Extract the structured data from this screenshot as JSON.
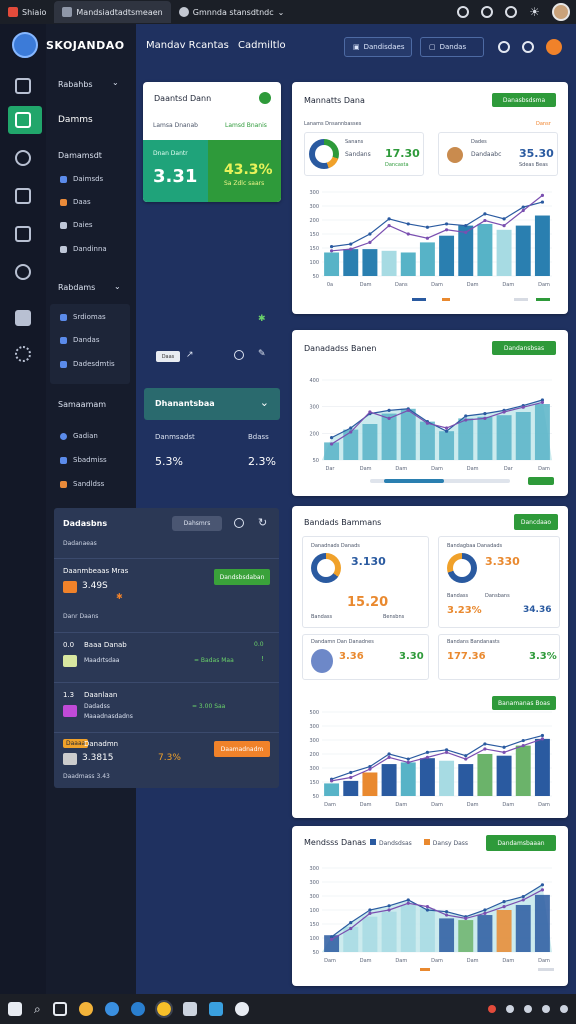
{
  "browser": {
    "tabs": [
      {
        "label": "Shiaio"
      },
      {
        "label": "Mandsiadtadtsmeaen"
      },
      {
        "label": "Gmnnda stansdtndc"
      }
    ]
  },
  "sidebar": {
    "brand": "SKOJANDAO",
    "section1": "Rabahbs",
    "active_item": "Damms",
    "group1_title": "Damamsdt",
    "group1_items": [
      "Daimsds",
      "Daas",
      "Daies",
      "Dandinna"
    ],
    "section2": "Rabdams",
    "group2_items": [
      "Srdiomas",
      "Dandas",
      "Dadesdmtis"
    ],
    "section3": "Samaamam",
    "group3_items": [
      "Gadian",
      "Sbadmiss",
      "Sandldss"
    ]
  },
  "header": {
    "title": "Mandav Rcantas",
    "subtitle": "Cadmiltlo",
    "btn1": "Dandisdaes",
    "btn2": "Dandas"
  },
  "kpi_card": {
    "title": "Daantsd Dann",
    "left_label": "Lamsa Dnanab",
    "right_label": "Lamsd Bnanis",
    "tile_caption": "Dnan Dantr",
    "tile_value": "3.31",
    "tile2_value": "43.3%",
    "tile2_caption": "Sa Zdlc saars"
  },
  "toolbar_mid": {
    "btn": "Daas"
  },
  "accordion": {
    "title": "Dhanantsbaa",
    "label": "Danmsadst",
    "right_label": "Bdass",
    "value_left": "5.3%",
    "value_right": "2.3%"
  },
  "left_panel": {
    "title": "Dadasbns",
    "btn": "Dahsmrs",
    "subtitle": "Dadanaeas",
    "row1": {
      "title": "Daanmbeaas Mras",
      "value": "3.49S",
      "btn": "Dandsbsdaban",
      "caption": "Danr Daans"
    },
    "row2": {
      "code": "0.0",
      "title": "Baaa Danab",
      "sub": "Maadrtsdaa",
      "mid": "= Badas Maa",
      "right_badge": "0.0"
    },
    "row3": {
      "code": "1.3",
      "title": "Daanlaan",
      "sub": "Dadadss",
      "sub2": "Maaadnasdadns",
      "mid": "= 3.00 Saa"
    },
    "row4": {
      "badge": "Daaaa",
      "title": "Danadmn",
      "value": "3.3815",
      "pct": "7.3%",
      "btn": "Daamadnadm",
      "caption": "Daadmass 3.43"
    }
  },
  "chart1": {
    "title": "Mannatts Dana",
    "btn": "Danasbsdsma",
    "mini_left": {
      "label": "Sanans",
      "title": "Sandans",
      "value": "17.30",
      "caption": "Dancasta"
    },
    "mini_right": {
      "label": "Dades",
      "title": "Dandaabc",
      "value": "35.30",
      "caption": "Sdeas Beas"
    },
    "header_left": "Lanams Dnsannbasses",
    "header_right": "Dansr"
  },
  "chart2": {
    "title": "Danadadss Banen",
    "btn": "Dandansbsas"
  },
  "chart3": {
    "title": "Bandads Bammans",
    "btn": "Dancdaao",
    "stat1": {
      "title": "Danadnads Danads",
      "value": "3.130",
      "value2": "15.20",
      "label_a": "Bandass",
      "label_b": "Bensbns"
    },
    "stat2": {
      "title": "Bandagbaa Danadads",
      "value": "3.330",
      "value2": "3.23%",
      "label_a": "Bandass",
      "label_b": "Dansbans",
      "value3": "34.36"
    },
    "stat3": {
      "title": "Dandamn Dan Danadnes",
      "value": "3.36",
      "value2": "3.30"
    },
    "stat4": {
      "title": "Bandans Bandanasts",
      "value": "177.36",
      "value2": "3.3%"
    },
    "inner_btn": "Banamanas Boas"
  },
  "chart4": {
    "title": "Mendsss Danas",
    "legend": [
      {
        "label": "Dandsdsas",
        "color": "#2a5aa0"
      },
      {
        "label": "Dansy Dass",
        "color": "#e9892f"
      }
    ],
    "btn": "Dandamsbaaan"
  },
  "colors": {
    "green": "#2e9a3a",
    "teal": "#57b3c7",
    "blue": "#2a5aa0",
    "orange": "#f0822a"
  },
  "chart_data": [
    {
      "type": "bar",
      "id": "chart1",
      "y_ticks": [
        "300",
        "300",
        "200",
        "150",
        "150",
        "100",
        "50"
      ],
      "x_ticks": [
        "0a",
        "Dam",
        "Dans",
        "Dam",
        "Dam",
        "Dam",
        "Dam"
      ],
      "bars": [
        28,
        32,
        32,
        30,
        28,
        40,
        48,
        60,
        62,
        55,
        60,
        72
      ],
      "bar_colors": [
        "#57b3c7",
        "#2a7fb0",
        "#2a7fb0",
        "#a7dbe3",
        "#57b3c7",
        "#57b3c7",
        "#2a7fb0",
        "#2a7fb0",
        "#57b3c7",
        "#a7dbe3",
        "#2a7fb0",
        "#2a7fb0"
      ],
      "line1": [
        35,
        38,
        50,
        68,
        62,
        58,
        62,
        60,
        74,
        68,
        82,
        88
      ],
      "line2": [
        30,
        32,
        40,
        60,
        50,
        45,
        55,
        52,
        66,
        60,
        78,
        96
      ]
    },
    {
      "type": "area",
      "id": "chart2",
      "y_ticks": [
        "400",
        "300",
        "200",
        "50"
      ],
      "x_ticks": [
        "Dar",
        "Dam",
        "Dam",
        "Dam",
        "Dam",
        "Dar",
        "Dam"
      ],
      "bars": [
        22,
        38,
        45,
        58,
        64,
        48,
        36,
        52,
        54,
        56,
        60,
        70
      ],
      "line1": [
        28,
        40,
        58,
        62,
        64,
        48,
        36,
        55,
        58,
        62,
        68,
        75
      ],
      "line2": [
        20,
        35,
        60,
        52,
        62,
        46,
        40,
        50,
        52,
        60,
        66,
        72
      ]
    },
    {
      "type": "bar",
      "id": "chart3",
      "y_ticks": [
        "500",
        "300",
        "300",
        "200",
        "300",
        "150",
        "50"
      ],
      "x_ticks": [
        "Dam",
        "Dam",
        "Dam",
        "Dam",
        "Dam",
        "Dam",
        "Dam"
      ],
      "bars": [
        15,
        18,
        28,
        38,
        40,
        45,
        42,
        38,
        50,
        48,
        60,
        68
      ],
      "bar_colors": [
        "#57b3c7",
        "#2a5aa0",
        "#e9892f",
        "#2a5aa0",
        "#57b3c7",
        "#2a5aa0",
        "#a7dbe3",
        "#2a5aa0",
        "#6bb36a",
        "#2a5aa0",
        "#6bb36a",
        "#2a5aa0"
      ],
      "line1": [
        20,
        28,
        35,
        50,
        44,
        52,
        55,
        48,
        62,
        58,
        66,
        72
      ],
      "line2": [
        18,
        22,
        32,
        46,
        40,
        46,
        52,
        44,
        56,
        52,
        60,
        68
      ]
    },
    {
      "type": "area",
      "id": "chart4",
      "y_ticks": [
        "300",
        "300",
        "300",
        "100",
        "150",
        "100",
        "50"
      ],
      "x_ticks": [
        "Dam",
        "Dam",
        "Dam",
        "Dam",
        "Dam",
        "Dam",
        "Dam"
      ],
      "bars": [
        20,
        30,
        42,
        48,
        56,
        52,
        40,
        38,
        44,
        50,
        56,
        68
      ],
      "bar_colors": [
        "#2a5aa0",
        "#a7dbe3",
        "#a7dbe3",
        "#a7dbe3",
        "#a7dbe3",
        "#a7dbe3",
        "#2a5aa0",
        "#6bb36a",
        "#2a5aa0",
        "#e9892f",
        "#2a5aa0",
        "#2a5aa0"
      ],
      "line1": [
        18,
        35,
        50,
        55,
        62,
        50,
        48,
        42,
        50,
        60,
        66,
        80
      ],
      "line2": [
        15,
        28,
        46,
        50,
        58,
        54,
        44,
        40,
        46,
        54,
        62,
        74
      ]
    }
  ]
}
